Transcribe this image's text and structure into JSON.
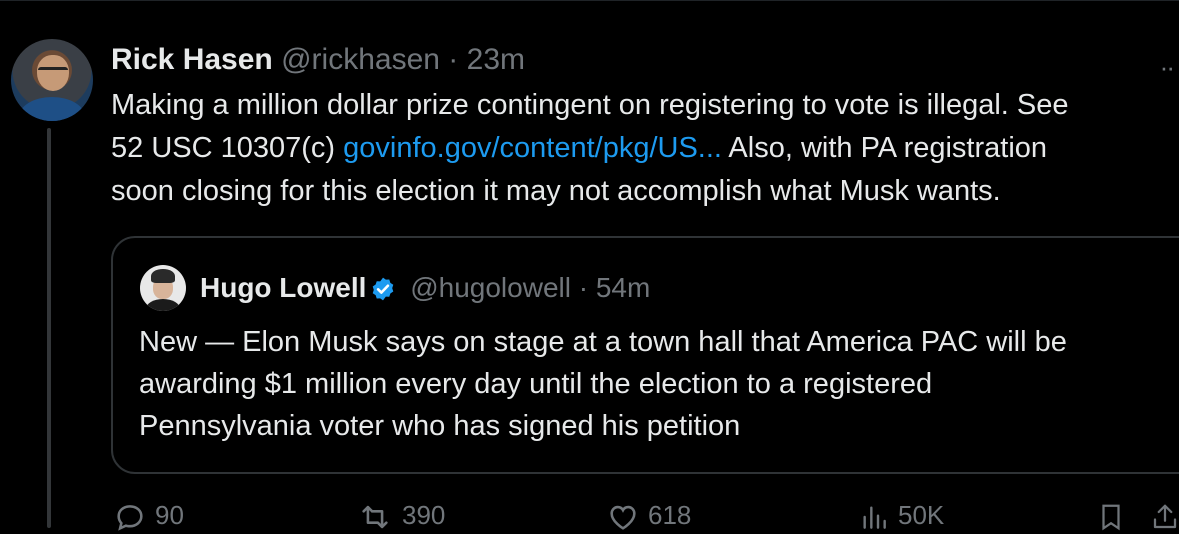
{
  "tweet": {
    "author_name": "Rick Hasen",
    "author_handle": "@rickhasen",
    "separator": "·",
    "time": "23m",
    "more_label": "··",
    "text_line1": "Making a million dollar prize contingent on registering to vote is illegal. See",
    "text_line2_pre": "52 USC 10307(c) ",
    "link": "govinfo.gov/content/pkg/US...",
    "text_line2_post": " Also, with PA registration",
    "text_line3": "soon closing for this election it may not accomplish what Musk wants."
  },
  "quote": {
    "author_name": "Hugo Lowell",
    "author_handle": "@hugolowell",
    "separator": "·",
    "time": "54m",
    "text_line1": "New — Elon Musk says on stage at a town hall that America PAC will be",
    "text_line2": "awarding $1 million every day until the election to a registered",
    "text_line3": "Pennsylvania voter who has signed his petition"
  },
  "actions": {
    "replies": "90",
    "reposts": "390",
    "likes": "618",
    "views": "50K"
  },
  "colors": {
    "background": "#000000",
    "text": "#e7e9ea",
    "muted": "#71767b",
    "link": "#1d9bf0",
    "border": "#2f3336",
    "verified": "#1d9bf0"
  }
}
